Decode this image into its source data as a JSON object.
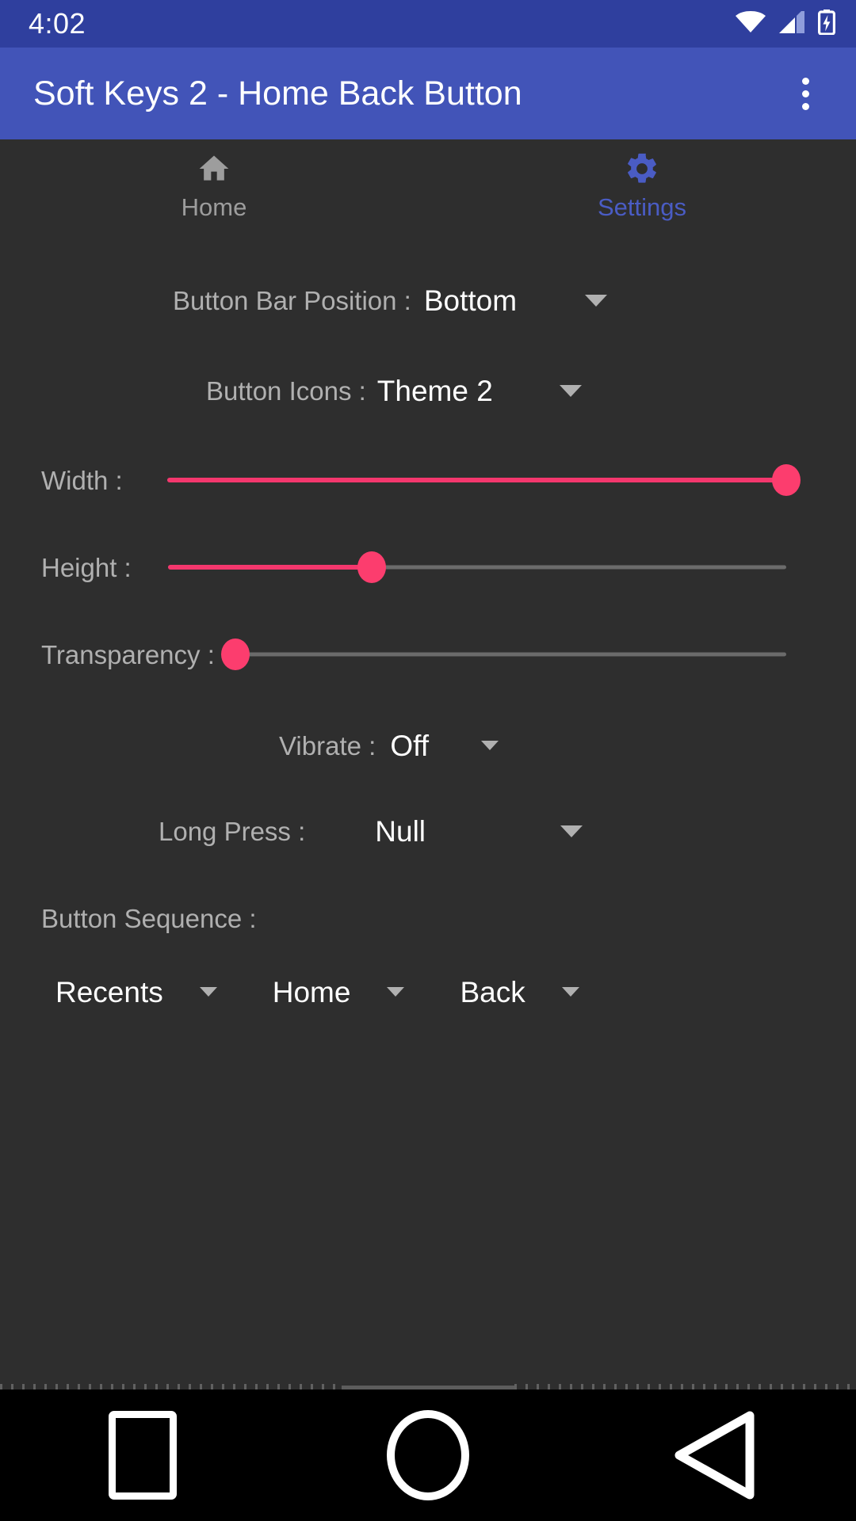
{
  "status_bar": {
    "time": "4:02",
    "icons": [
      "wifi-icon",
      "cellular-signal-icon",
      "battery-charging-icon"
    ],
    "background": "#2f3f9e"
  },
  "app_bar": {
    "title": "Soft Keys 2 - Home Back Button",
    "overflow_menu": "overflow-menu-icon",
    "background": "#4254b8"
  },
  "tabs": [
    {
      "label": "Home",
      "icon": "home-icon",
      "selected": false,
      "color": "#9d9d9d"
    },
    {
      "label": "Settings",
      "icon": "gear-icon",
      "selected": true,
      "color": "#4a5cc4"
    }
  ],
  "settings": {
    "button_bar_position": {
      "label": "Button Bar Position :",
      "value": "Bottom"
    },
    "button_icons": {
      "label": "Button Icons :",
      "value": "Theme 2"
    },
    "width": {
      "label": "Width :",
      "percent": 100
    },
    "height": {
      "label": "Height :",
      "percent": 33
    },
    "transparency": {
      "label": "Transparency :",
      "percent": 0
    },
    "vibrate": {
      "label": "Vibrate :",
      "value": "Off"
    },
    "long_press": {
      "label": "Long Press :",
      "value": "Null"
    },
    "button_sequence": {
      "label": "Button Sequence :",
      "slots": [
        {
          "value": "Recents"
        },
        {
          "value": "Home"
        },
        {
          "value": "Back"
        }
      ]
    }
  },
  "colors": {
    "content_background": "#2e2e2e",
    "slider_accent": "#fc3d6e",
    "slider_track": "#6b6b6b",
    "label_text": "#b0b0b0",
    "value_text": "#ffffff"
  },
  "nav_bar": {
    "buttons": [
      {
        "name": "recents",
        "icon": "square-icon"
      },
      {
        "name": "home",
        "icon": "circle-icon"
      },
      {
        "name": "back",
        "icon": "triangle-left-icon"
      }
    ],
    "background": "#000000"
  }
}
